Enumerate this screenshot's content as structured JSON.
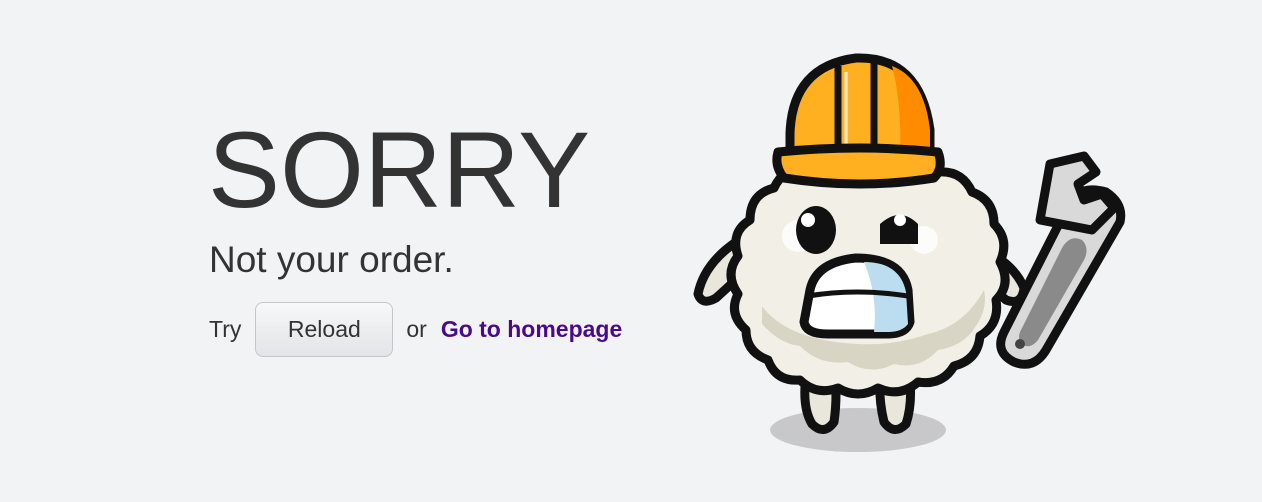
{
  "error": {
    "headline": "SORRY",
    "message": "Not your order.",
    "try_word": "Try",
    "reload_label": "Reload",
    "or_word": "or",
    "homepage_link": "Go to homepage"
  },
  "colors": {
    "background": "#f2f3f5",
    "text": "#333333",
    "link": "#4b0a8c",
    "helmet": "#ffa51f"
  },
  "illustration": {
    "icon": "rice-ball-mascot-with-helmet-and-wrench"
  }
}
